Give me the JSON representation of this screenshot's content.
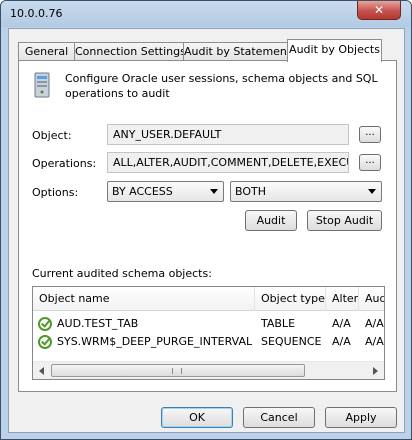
{
  "window": {
    "title": "10.0.0.76",
    "close_glyph": "✕"
  },
  "tabs": [
    {
      "label": "General"
    },
    {
      "label": "Connection Settings"
    },
    {
      "label": "Audit by Statements"
    },
    {
      "label": "Audit by Objects",
      "active": true
    }
  ],
  "panel": {
    "icon": "server-icon",
    "description": "Configure Oracle user sessions, schema objects and SQL operations to audit",
    "object": {
      "label": "Object:",
      "value": "ANY_USER.DEFAULT",
      "browse_label": "..."
    },
    "operations": {
      "label": "Operations:",
      "value": "ALL,ALTER,AUDIT,COMMENT,DELETE,EXECUT",
      "browse_label": "..."
    },
    "options": {
      "label": "Options:",
      "by_value": "BY ACCESS",
      "when_value": "BOTH"
    },
    "audit_button": "Audit",
    "stop_audit_button": "Stop Audit",
    "list_label": "Current audited schema objects:",
    "columns": [
      "Object name",
      "Object type",
      "Alter",
      "Aud"
    ],
    "rows": [
      {
        "name": "AUD.TEST_TAB",
        "type": "TABLE",
        "alter": "A/A",
        "aud": "A/A"
      },
      {
        "name": "SYS.WRM$_DEEP_PURGE_INTERVAL",
        "type": "SEQUENCE",
        "alter": "A/A",
        "aud": "A/A"
      }
    ],
    "status_icon": "check-circle-icon"
  },
  "footer": {
    "ok": "OK",
    "cancel": "Cancel",
    "apply": "Apply"
  },
  "colors": {
    "titlebar": "#b9d1ea",
    "close_button": "#c75050",
    "check": "#4e9a2a"
  }
}
